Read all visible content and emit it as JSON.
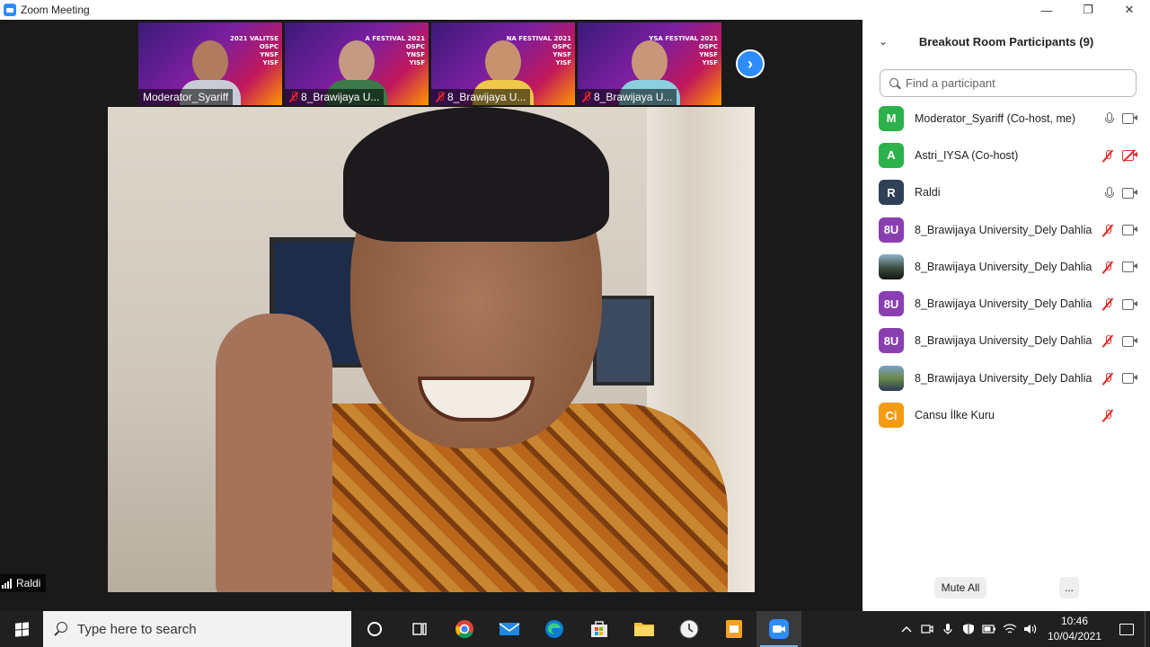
{
  "window": {
    "title": "Zoom Meeting",
    "controls": {
      "minimize": "—",
      "maximize": "❐",
      "close": "✕"
    }
  },
  "gallery": {
    "thumbnails": [
      {
        "name": "Moderator_Syariff",
        "muted": false,
        "banner": [
          "2021 VALITSE",
          "OSPC",
          "YNSF",
          "YISF"
        ],
        "skin": "#b07b5e",
        "shirt": "#c9ccd6"
      },
      {
        "name": "8_Brawijaya U...",
        "muted": true,
        "banner": [
          "A FESTIVAL 2021",
          "OSPC",
          "YNSF",
          "YISF"
        ],
        "skin": "#c49a80",
        "shirt": "#3c7a4a"
      },
      {
        "name": "8_Brawijaya U...",
        "muted": true,
        "banner": [
          "NA FESTIVAL 2021",
          "OSPC",
          "YNSF",
          "YISF"
        ],
        "skin": "#c7936f",
        "shirt": "#f0c84a"
      },
      {
        "name": "8_Brawijaya U...",
        "muted": true,
        "banner": [
          "YSA FESTIVAL 2021",
          "OSPC",
          "YNSF",
          "YISF"
        ],
        "skin": "#c8977a",
        "shirt": "#8ad0e0"
      }
    ],
    "next_icon": "chevron-right-icon"
  },
  "active_speaker": {
    "name": "Raldi"
  },
  "panel": {
    "title": "Breakout Room Participants (9)",
    "search_placeholder": "Find a participant",
    "participants": [
      {
        "initials": "M",
        "color": "#2db14a",
        "name": "Moderator_Syariff (Co-host, me)",
        "mic": "on",
        "cam": "on",
        "photo": false
      },
      {
        "initials": "A",
        "color": "#2db14a",
        "name": "Astri_IYSA (Co-host)",
        "mic": "off",
        "cam": "off",
        "photo": false
      },
      {
        "initials": "R",
        "color": "#2f4157",
        "name": "Raldi",
        "mic": "on",
        "cam": "on",
        "photo": false
      },
      {
        "initials": "8U",
        "color": "#8a3fb0",
        "name": "8_Brawijaya University_Dely Dahlia",
        "mic": "off",
        "cam": "on",
        "photo": false
      },
      {
        "initials": "",
        "color": "#3a4a3a",
        "name": "8_Brawijaya University_Dely Dahlia",
        "mic": "off",
        "cam": "on",
        "photo": true
      },
      {
        "initials": "8U",
        "color": "#8a3fb0",
        "name": "8_Brawijaya University_Dely Dahlia",
        "mic": "off",
        "cam": "on",
        "photo": false
      },
      {
        "initials": "8U",
        "color": "#8a3fb0",
        "name": "8_Brawijaya University_Dely Dahlia",
        "mic": "off",
        "cam": "on",
        "photo": false
      },
      {
        "initials": "",
        "color": "#4a6a3a",
        "name": "8_Brawijaya University_Dely Dahlia",
        "mic": "off",
        "cam": "on",
        "photo": true
      },
      {
        "initials": "Ci",
        "color": "#f39c12",
        "name": "Cansu İlke Kuru",
        "mic": "off",
        "cam": "none",
        "photo": false
      }
    ],
    "mute_all_label": "Mute All",
    "more_label": "..."
  },
  "taskbar": {
    "search_placeholder": "Type here to search",
    "apps": [
      {
        "name": "cortana-icon",
        "active": false
      },
      {
        "name": "task-view-icon",
        "active": false
      },
      {
        "name": "chrome-icon",
        "active": false
      },
      {
        "name": "mail-icon",
        "active": false
      },
      {
        "name": "edge-icon",
        "active": false
      },
      {
        "name": "store-icon",
        "active": false
      },
      {
        "name": "file-explorer-icon",
        "active": false
      },
      {
        "name": "clock-app-icon",
        "active": false
      },
      {
        "name": "google-slides-icon",
        "active": false
      },
      {
        "name": "zoom-icon",
        "active": true
      }
    ],
    "time": "10:46",
    "date": "10/04/2021"
  },
  "colors": {
    "accent": "#2d8cff",
    "muted_red": "#e02828",
    "taskbar": "#202020"
  }
}
